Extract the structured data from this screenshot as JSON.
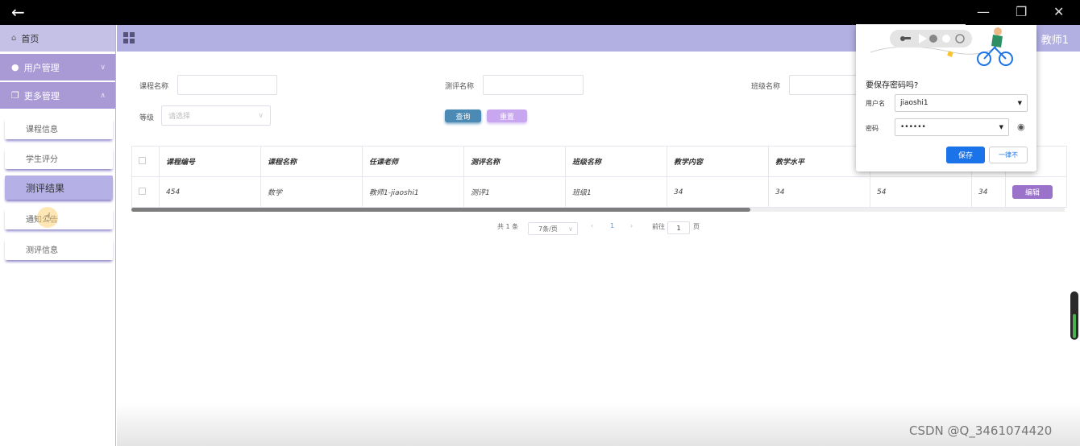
{
  "app": {
    "teacher": "教师1",
    "watermark": "CSDN @Q_3461074420"
  },
  "sidebar": {
    "home": "首页",
    "groups": [
      {
        "label": "用户管理",
        "expanded": false
      },
      {
        "label": "更多管理",
        "expanded": true
      }
    ],
    "items": [
      {
        "label": "课程信息"
      },
      {
        "label": "学生评分"
      },
      {
        "label": "测评结果",
        "active": true
      },
      {
        "label": "通知公告"
      },
      {
        "label": "测评信息"
      }
    ]
  },
  "search": {
    "course_name_label": "课程名称",
    "eval_name_label": "测评名称",
    "class_name_label": "班级名称",
    "grade_label": "等级",
    "grade_placeholder": "请选择",
    "query_button": "查询",
    "reset_button": "重置"
  },
  "table": {
    "columns": [
      "课程编号",
      "课程名称",
      "任课老师",
      "测评名称",
      "班级名称",
      "教学内容",
      "教学水平"
    ],
    "rows": [
      {
        "c0": "454",
        "c1": "数学",
        "c2": "教师1-jiaoshi1",
        "c3": "测评1",
        "c4": "班级1",
        "c5": "34",
        "c6": "34",
        "c7": "54",
        "c8": "34",
        "action": "编辑"
      }
    ]
  },
  "pager": {
    "total": "共 1 条",
    "page_size": "7条/页",
    "current": "1",
    "goto_label": "前往",
    "goto_value": "1",
    "page_unit": "页"
  },
  "password_popup": {
    "title": "要保存密码吗?",
    "username_label": "用户名",
    "username": "jiaoshi1",
    "password_label": "密码",
    "password": "••••••",
    "save": "保存",
    "never": "一律不"
  },
  "colors": {
    "accent": "#b2b0e3",
    "sidebar_group": "#a99ad6",
    "query": "#4b8ab5",
    "reset": "#c8a6f0",
    "edit": "#9b72c9",
    "save_blue": "#1a73e8"
  }
}
